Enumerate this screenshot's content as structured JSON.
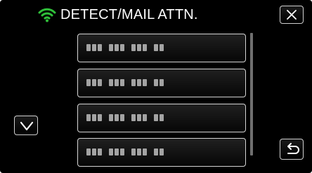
{
  "header": {
    "title": "DETECT/MAIL ATTN.",
    "wifi_icon": "wifi-icon",
    "wifi_color": "#2fbf3a",
    "close_icon": "close-icon"
  },
  "list": {
    "items": [
      {
        "label": "email-address-entry"
      },
      {
        "label": "email-address-entry"
      },
      {
        "label": "email-address-entry"
      },
      {
        "label": "email-address-entry"
      }
    ]
  },
  "controls": {
    "scroll_down_icon": "chevron-down-icon",
    "back_icon": "return-arrow-icon"
  }
}
